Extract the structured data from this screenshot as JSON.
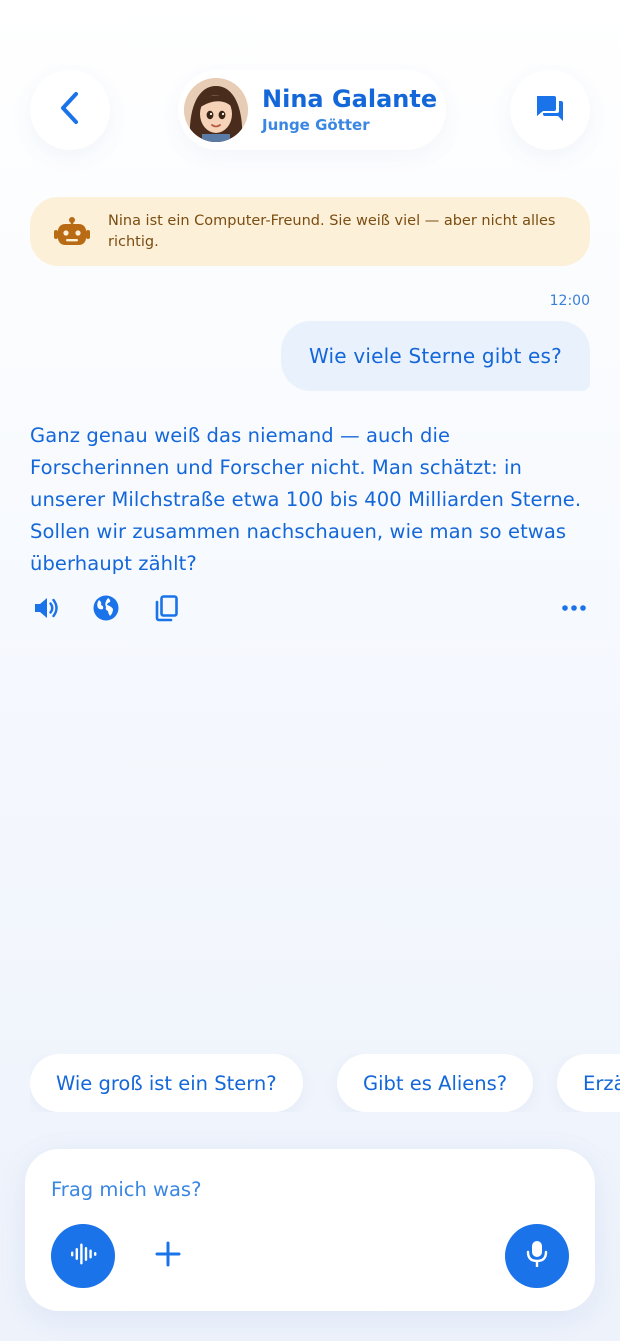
{
  "header": {
    "name": "Nina Galante",
    "subtitle": "Junge Götter"
  },
  "notice": {
    "text": "Nina ist ein Computer-Freund. Sie weiß viel — aber nicht alles richtig.",
    "icon": "robot-icon"
  },
  "conversation": {
    "timestamp": "12:00",
    "user_message": "Wie viele Sterne gibt es?",
    "assistant_message": "Ganz genau weiß das niemand — auch die Forscherinnen und Forscher nicht. Man schätzt: in unserer Milchstraße etwa 100 bis 400 Milliarden Sterne. Sollen wir zusammen nachschauen, wie man so etwas überhaupt zählt?"
  },
  "message_actions": [
    "speaker-icon",
    "globe-icon",
    "copy-icon",
    "more-icon"
  ],
  "suggestions": [
    "Wie groß ist ein Stern?",
    "Gibt es Aliens?",
    "Erzä"
  ],
  "composer": {
    "placeholder": "Frag mich was?"
  },
  "colors": {
    "accent": "#1a73e8",
    "text_blue": "#1467d9",
    "notice_bg": "#fdf0d8",
    "notice_text": "#7a4d12",
    "bubble_bg": "#e9f1fc"
  }
}
